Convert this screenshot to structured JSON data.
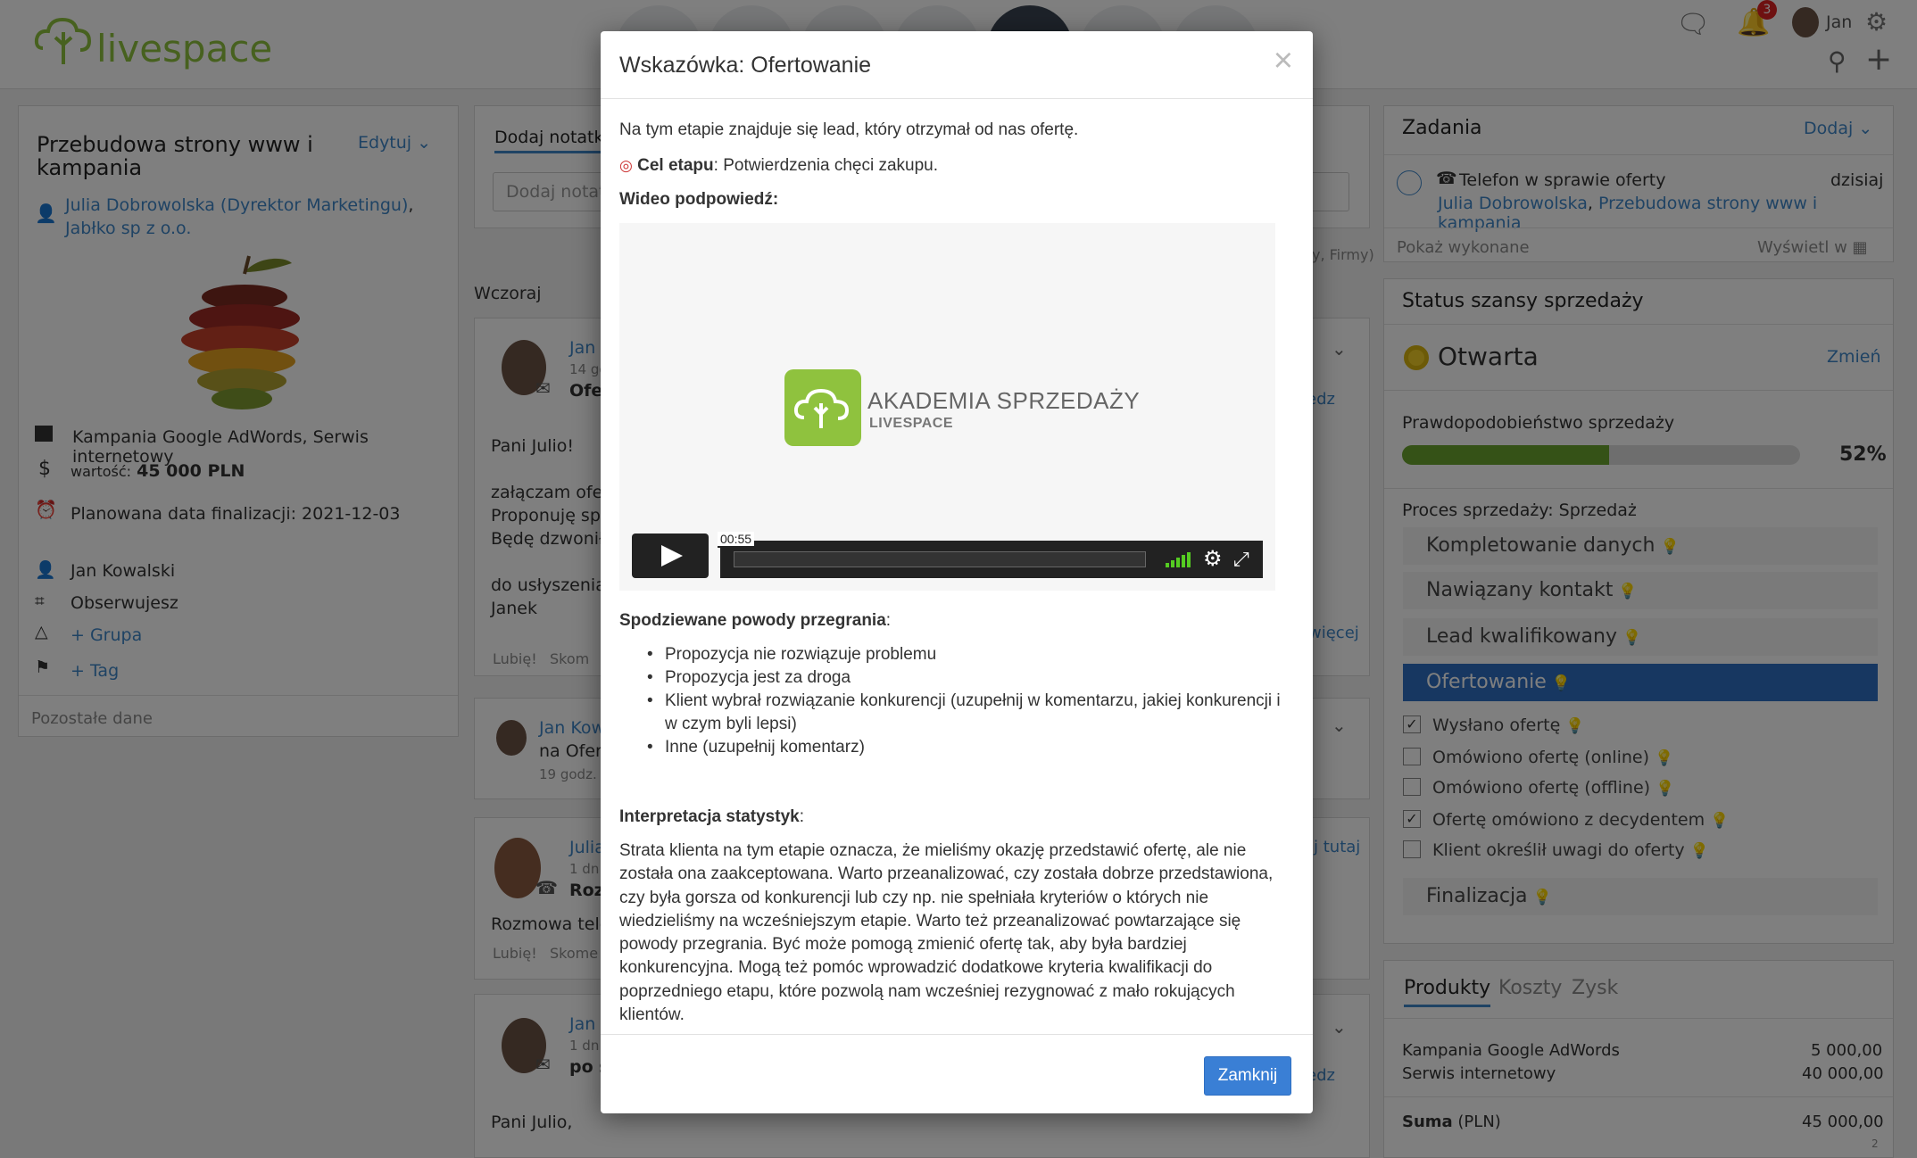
{
  "app": {
    "logo_text": "livespace"
  },
  "topbar": {
    "user_name": "Jan",
    "notification_count": "3"
  },
  "deal": {
    "title": "Przebudowa strony www i kampania",
    "edit_label": "Edytuj",
    "contact": "Julia Dobrowolska (Dyrektor Marketingu)",
    "company": "Jabłko sp z o.o.",
    "products": "Kampania Google AdWords, Serwis internetowy",
    "value_label": "wartość:",
    "value": "45 000 PLN",
    "planned_date": "Planowana data finalizacji: 2021-12-03",
    "owner": "Jan Kowalski",
    "follow": "Obserwujesz",
    "group": "+ Grupa",
    "tag": "+ Tag",
    "other_data": "Pozostałe dane"
  },
  "notes": {
    "tab_label": "Dodaj notatkę",
    "input_placeholder": "Dodaj notatkę",
    "hint_tail": "y, Firmy)",
    "yesterday": "Wczoraj",
    "items": [
      {
        "author": "Jan",
        "time": "14 go",
        "subject": "Ofer",
        "link": "edz",
        "body1": "Pani Julio!",
        "body2": "załączam ofert",
        "body3": "Proponuję spo",
        "body4": "Będę dzwonił v",
        "body5": "do usłyszenia,",
        "body6": "Janek",
        "more": "więcej",
        "like": "Lubię!",
        "comment": "Skom"
      },
      {
        "author": "Jan Kow",
        "subject": "na Ofert",
        "time": "19 godz."
      },
      {
        "author": "Julia",
        "time": "1 dn.",
        "subject": "Rozm",
        "body": "Rozmowa telef",
        "link": "j tutaj",
        "like": "Lubię!",
        "comment": "Skome"
      },
      {
        "author": "Jan",
        "time": "1 dn.",
        "subject": "po s",
        "link": "edz",
        "body": "Pani Julio,"
      }
    ]
  },
  "modal": {
    "title": "Wskazówka: Ofertowanie",
    "intro": "Na tym etapie znajduje się lead, który otrzymał od nas ofertę.",
    "goal_label": "Cel etapu",
    "goal_text": ": Potwierdzenia chęci zakupu.",
    "video_label": "Wideo podpowiedź:",
    "video": {
      "brand_line1": "AKADEMIA SPRZEDAŻY",
      "brand_line2": "LIVESPACE",
      "time": "00:55",
      "progress": 0.0
    },
    "loss_title": "Spodziewane powody przegrania",
    "loss_reasons": [
      "Propozycja nie rozwiązuje problemu",
      "Propozycja jest za droga",
      "Klient wybrał rozwiązanie konkurencji (uzupełnij w komentarzu, jakiej konkurencji i w czym byli lepsi)",
      "Inne (uzupełnij komentarz)"
    ],
    "stats_title": "Interpretacja statystyk",
    "stats_text": "Strata klienta na tym etapie oznacza, że mieliśmy okazję przedstawić ofertę, ale nie została ona zaakceptowana. Warto przeanalizować, czy została dobrze przedstawiona, czy była gorsza od konkurencji lub czy np. nie spełniała kryteriów o których nie wiedzieliśmy na wcześniejszym etapie. Warto też przeanalizować powtarzające się powody przegrania. Być może pomogą zmienić ofertę tak, aby była bardziej konkurencyjna. Mogą też pomóc wprowadzić dodatkowe kryteria kwalifikacji do poprzedniego etapu, które pozwolą nam wcześniej rezygnować z mało rokujących klientów.",
    "close_button": "Zamknij"
  },
  "tasks": {
    "title": "Zadania",
    "add": "Dodaj",
    "task_title": "Telefon w sprawie oferty",
    "task_date": "dzisiaj",
    "task_contact": "Julia Dobrowolska",
    "task_deal": "Przebudowa strony www i kampania",
    "show_done": "Pokaż wykonane",
    "show_in": "Wyświetl w"
  },
  "status": {
    "title": "Status szansy sprzedaży",
    "state": "Otwarta",
    "change": "Zmień",
    "probability_label": "Prawdopodobieństwo sprzedaży",
    "probability": "52%",
    "probability_value": 0.52,
    "process": "Proces sprzedaży: Sprzedaż",
    "stages": [
      "Kompletowanie danych",
      "Nawiązany kontakt",
      "Lead kwalifikowany",
      "Ofertowanie",
      "Finalizacja"
    ],
    "checklist": [
      {
        "label": "Wysłano ofertę",
        "checked": true
      },
      {
        "label": "Omówiono ofertę (online)",
        "checked": false
      },
      {
        "label": "Omówiono ofertę (offline)",
        "checked": false
      },
      {
        "label": "Ofertę omówiono z decydentem",
        "checked": true
      },
      {
        "label": "Klient określił uwagi do oferty",
        "checked": false
      }
    ]
  },
  "products": {
    "tabs": [
      "Produkty",
      "Koszty",
      "Zysk"
    ],
    "items": [
      {
        "name": "Kampania Google AdWords",
        "price": "5 000,00"
      },
      {
        "name": "Serwis internetowy",
        "price": "40 000,00"
      }
    ],
    "sum_label": "Suma",
    "sum_currency": " (PLN)",
    "sum_value": "45 000,00",
    "count": "2"
  },
  "colors": {
    "accent": "#3f87c9",
    "active_stage": "#2f6fc2",
    "progress": "#6aa42f",
    "button": "#3a7fd5"
  }
}
